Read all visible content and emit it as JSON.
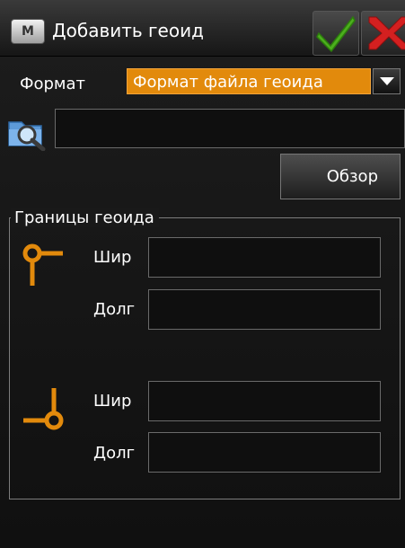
{
  "header": {
    "menu_label": "M",
    "title": "Добавить геоид",
    "ok_icon": "checkmark-icon",
    "cancel_icon": "close-icon"
  },
  "format": {
    "label": "Формат",
    "value": "Формат файла геоида"
  },
  "file": {
    "icon": "search-file-icon",
    "value": "",
    "browse_label": "Обзор"
  },
  "bounds": {
    "legend": "Границы геоида",
    "top_left": {
      "icon": "top-left-corner-icon",
      "lat_label": "Шир",
      "lat_value": "",
      "lon_label": "Долг",
      "lon_value": ""
    },
    "bottom_right": {
      "icon": "bottom-right-corner-icon",
      "lat_label": "Шир",
      "lat_value": "",
      "lon_label": "Долг",
      "lon_value": ""
    }
  },
  "colors": {
    "accent": "#e28a0c",
    "background": "#161616",
    "ok_green": "#4caf1e",
    "cancel_red": "#d42020"
  }
}
